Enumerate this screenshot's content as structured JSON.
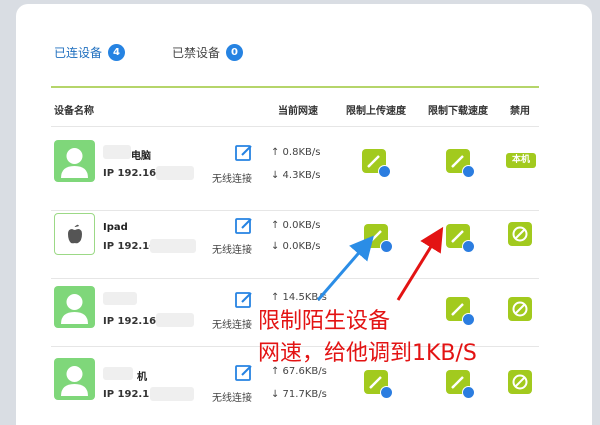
{
  "tabs": [
    {
      "label": "已连设备",
      "count": "4"
    },
    {
      "label": "已禁设备",
      "count": "0"
    }
  ],
  "columns": {
    "device_name": "设备名称",
    "current_speed": "当前网速",
    "upload_limit": "限制上传速度",
    "download_limit": "限制下载速度",
    "disable": "禁用"
  },
  "devices": [
    {
      "name": "电脑",
      "ip": "IP 192.16",
      "connection": "无线连接",
      "up": "↑ 0.8KB/s",
      "down": "↓ 4.3KB/s",
      "local_label": "本机",
      "icon": "user-icon"
    },
    {
      "name": "Ipad",
      "ip": "IP 192.16",
      "connection": "无线连接",
      "up": "↑ 0.0KB/s",
      "down": "↓ 0.0KB/s",
      "icon": "apple-icon"
    },
    {
      "name": "",
      "ip": "IP 192.16",
      "connection": "无线连接",
      "up": "↑ 14.5KB/s",
      "down": "↓",
      "icon": "user-icon"
    },
    {
      "name": "机",
      "ip": "IP 192.1",
      "connection": "无线连接",
      "up": "↑ 67.6KB/s",
      "down": "↓ 71.7KB/s",
      "icon": "user-icon"
    }
  ],
  "annotation": {
    "line1": "限制陌生设备",
    "line2": "网速，给他调到1KB/S",
    "color": "#e31313"
  },
  "colors": {
    "accent_green": "#a2ca1e",
    "accent_blue": "#2683e2"
  }
}
